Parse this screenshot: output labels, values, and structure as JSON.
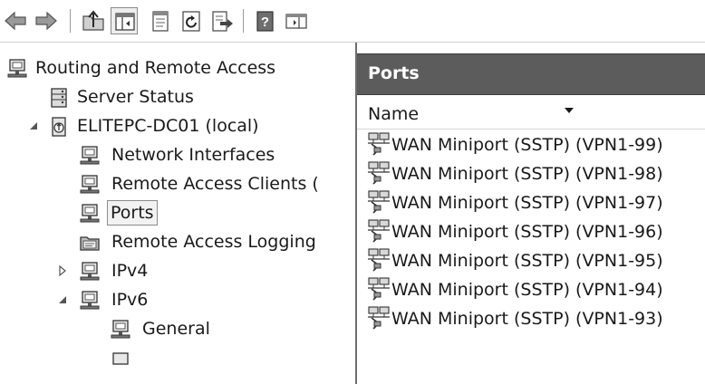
{
  "toolbar": {
    "buttons": [
      {
        "name": "back-button",
        "icon": "arrow-left-icon"
      },
      {
        "name": "forward-button",
        "icon": "arrow-right-icon"
      },
      {
        "name": "up-one-level-button",
        "icon": "folder-up-icon"
      },
      {
        "name": "show-hide-console-tree-button",
        "icon": "console-tree-icon"
      },
      {
        "name": "properties-button",
        "icon": "properties-icon"
      },
      {
        "name": "refresh-button",
        "icon": "refresh-icon"
      },
      {
        "name": "export-list-button",
        "icon": "export-list-icon"
      },
      {
        "name": "help-button",
        "icon": "help-icon",
        "label": "?"
      },
      {
        "name": "show-hide-action-pane-button",
        "icon": "action-pane-icon"
      }
    ]
  },
  "tree": {
    "root": {
      "label": "Routing and Remote Access",
      "icon": "server-icon"
    },
    "server_status": {
      "label": "Server Status",
      "icon": "server-status-icon"
    },
    "server": {
      "label": "ELITEPC-DC01 (local)",
      "icon": "server-computer-icon",
      "expanded": true
    },
    "network_interfaces": {
      "label": "Network Interfaces",
      "icon": "network-icon"
    },
    "remote_access_clients": {
      "label": "Remote Access Clients (",
      "icon": "network-icon"
    },
    "ports": {
      "label": "Ports",
      "icon": "network-icon",
      "selected": true
    },
    "remote_access_logging": {
      "label": "Remote Access Logging",
      "icon": "log-folder-icon"
    },
    "ipv4": {
      "label": "IPv4",
      "icon": "network-icon",
      "expanded": false
    },
    "ipv6": {
      "label": "IPv6",
      "icon": "network-icon",
      "expanded": true
    },
    "general": {
      "label": "General",
      "icon": "network-icon"
    }
  },
  "results": {
    "header_title": "Ports",
    "columns": [
      {
        "label": "Name",
        "sort": "descending"
      }
    ],
    "rows": [
      "WAN Miniport (SSTP) (VPN1-99)",
      "WAN Miniport (SSTP) (VPN1-98)",
      "WAN Miniport (SSTP) (VPN1-97)",
      "WAN Miniport (SSTP) (VPN1-96)",
      "WAN Miniport (SSTP) (VPN1-95)",
      "WAN Miniport (SSTP) (VPN1-94)",
      "WAN Miniport (SSTP) (VPN1-93)"
    ]
  },
  "colors": {
    "header_bg": "#5c5c5c",
    "selection_bg": "#f2f2f2",
    "splitter": "#6e6e6e"
  }
}
